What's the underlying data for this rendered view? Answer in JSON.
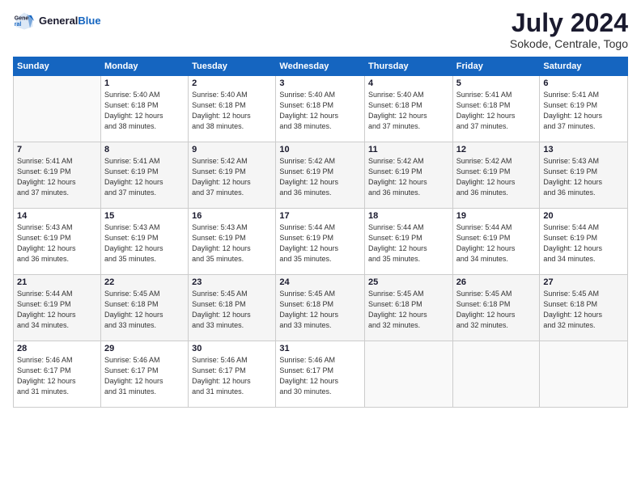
{
  "header": {
    "logo_line1": "General",
    "logo_line2": "Blue",
    "month": "July 2024",
    "location": "Sokode, Centrale, Togo"
  },
  "days_of_week": [
    "Sunday",
    "Monday",
    "Tuesday",
    "Wednesday",
    "Thursday",
    "Friday",
    "Saturday"
  ],
  "weeks": [
    [
      {
        "day": "",
        "info": ""
      },
      {
        "day": "1",
        "info": "Sunrise: 5:40 AM\nSunset: 6:18 PM\nDaylight: 12 hours\nand 38 minutes."
      },
      {
        "day": "2",
        "info": "Sunrise: 5:40 AM\nSunset: 6:18 PM\nDaylight: 12 hours\nand 38 minutes."
      },
      {
        "day": "3",
        "info": "Sunrise: 5:40 AM\nSunset: 6:18 PM\nDaylight: 12 hours\nand 38 minutes."
      },
      {
        "day": "4",
        "info": "Sunrise: 5:40 AM\nSunset: 6:18 PM\nDaylight: 12 hours\nand 37 minutes."
      },
      {
        "day": "5",
        "info": "Sunrise: 5:41 AM\nSunset: 6:18 PM\nDaylight: 12 hours\nand 37 minutes."
      },
      {
        "day": "6",
        "info": "Sunrise: 5:41 AM\nSunset: 6:19 PM\nDaylight: 12 hours\nand 37 minutes."
      }
    ],
    [
      {
        "day": "7",
        "info": "Sunrise: 5:41 AM\nSunset: 6:19 PM\nDaylight: 12 hours\nand 37 minutes."
      },
      {
        "day": "8",
        "info": "Sunrise: 5:41 AM\nSunset: 6:19 PM\nDaylight: 12 hours\nand 37 minutes."
      },
      {
        "day": "9",
        "info": "Sunrise: 5:42 AM\nSunset: 6:19 PM\nDaylight: 12 hours\nand 37 minutes."
      },
      {
        "day": "10",
        "info": "Sunrise: 5:42 AM\nSunset: 6:19 PM\nDaylight: 12 hours\nand 36 minutes."
      },
      {
        "day": "11",
        "info": "Sunrise: 5:42 AM\nSunset: 6:19 PM\nDaylight: 12 hours\nand 36 minutes."
      },
      {
        "day": "12",
        "info": "Sunrise: 5:42 AM\nSunset: 6:19 PM\nDaylight: 12 hours\nand 36 minutes."
      },
      {
        "day": "13",
        "info": "Sunrise: 5:43 AM\nSunset: 6:19 PM\nDaylight: 12 hours\nand 36 minutes."
      }
    ],
    [
      {
        "day": "14",
        "info": "Sunrise: 5:43 AM\nSunset: 6:19 PM\nDaylight: 12 hours\nand 36 minutes."
      },
      {
        "day": "15",
        "info": "Sunrise: 5:43 AM\nSunset: 6:19 PM\nDaylight: 12 hours\nand 35 minutes."
      },
      {
        "day": "16",
        "info": "Sunrise: 5:43 AM\nSunset: 6:19 PM\nDaylight: 12 hours\nand 35 minutes."
      },
      {
        "day": "17",
        "info": "Sunrise: 5:44 AM\nSunset: 6:19 PM\nDaylight: 12 hours\nand 35 minutes."
      },
      {
        "day": "18",
        "info": "Sunrise: 5:44 AM\nSunset: 6:19 PM\nDaylight: 12 hours\nand 35 minutes."
      },
      {
        "day": "19",
        "info": "Sunrise: 5:44 AM\nSunset: 6:19 PM\nDaylight: 12 hours\nand 34 minutes."
      },
      {
        "day": "20",
        "info": "Sunrise: 5:44 AM\nSunset: 6:19 PM\nDaylight: 12 hours\nand 34 minutes."
      }
    ],
    [
      {
        "day": "21",
        "info": "Sunrise: 5:44 AM\nSunset: 6:19 PM\nDaylight: 12 hours\nand 34 minutes."
      },
      {
        "day": "22",
        "info": "Sunrise: 5:45 AM\nSunset: 6:18 PM\nDaylight: 12 hours\nand 33 minutes."
      },
      {
        "day": "23",
        "info": "Sunrise: 5:45 AM\nSunset: 6:18 PM\nDaylight: 12 hours\nand 33 minutes."
      },
      {
        "day": "24",
        "info": "Sunrise: 5:45 AM\nSunset: 6:18 PM\nDaylight: 12 hours\nand 33 minutes."
      },
      {
        "day": "25",
        "info": "Sunrise: 5:45 AM\nSunset: 6:18 PM\nDaylight: 12 hours\nand 32 minutes."
      },
      {
        "day": "26",
        "info": "Sunrise: 5:45 AM\nSunset: 6:18 PM\nDaylight: 12 hours\nand 32 minutes."
      },
      {
        "day": "27",
        "info": "Sunrise: 5:45 AM\nSunset: 6:18 PM\nDaylight: 12 hours\nand 32 minutes."
      }
    ],
    [
      {
        "day": "28",
        "info": "Sunrise: 5:46 AM\nSunset: 6:17 PM\nDaylight: 12 hours\nand 31 minutes."
      },
      {
        "day": "29",
        "info": "Sunrise: 5:46 AM\nSunset: 6:17 PM\nDaylight: 12 hours\nand 31 minutes."
      },
      {
        "day": "30",
        "info": "Sunrise: 5:46 AM\nSunset: 6:17 PM\nDaylight: 12 hours\nand 31 minutes."
      },
      {
        "day": "31",
        "info": "Sunrise: 5:46 AM\nSunset: 6:17 PM\nDaylight: 12 hours\nand 30 minutes."
      },
      {
        "day": "",
        "info": ""
      },
      {
        "day": "",
        "info": ""
      },
      {
        "day": "",
        "info": ""
      }
    ]
  ]
}
